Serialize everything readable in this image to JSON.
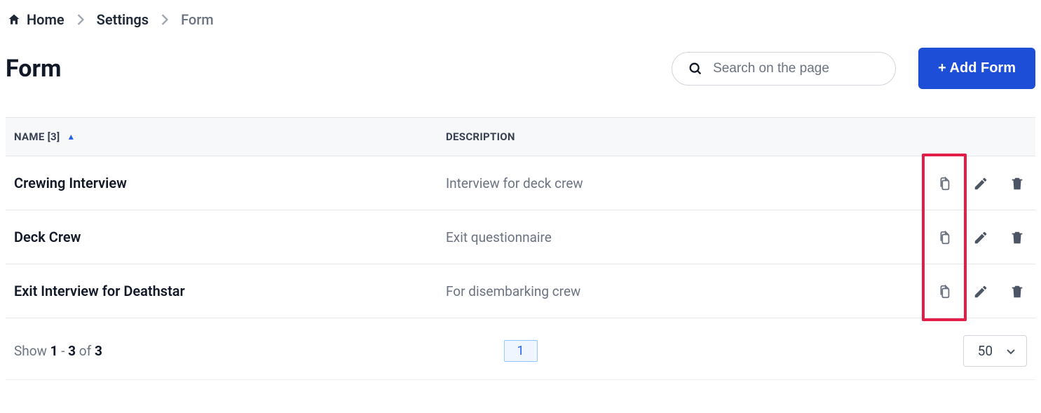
{
  "breadcrumb": {
    "home_label": "Home",
    "items": [
      {
        "label": "Settings"
      },
      {
        "label": "Form"
      }
    ]
  },
  "header": {
    "title": "Form",
    "search_placeholder": "Search on the page",
    "add_button_label": "+ Add Form"
  },
  "table": {
    "columns": {
      "name_label": "NAME [3]",
      "description_label": "DESCRIPTION"
    },
    "rows": [
      {
        "name": "Crewing Interview",
        "description": "Interview for deck crew"
      },
      {
        "name": "Deck Crew",
        "description": "Exit questionnaire"
      },
      {
        "name": "Exit Interview for Deathstar",
        "description": "For disembarking crew"
      }
    ]
  },
  "pagination": {
    "show_prefix": "Show ",
    "range_from": "1",
    "range_dash": " - ",
    "range_to": "3",
    "of_label": " of ",
    "total": "3",
    "current_page": "1",
    "page_size": "50"
  }
}
